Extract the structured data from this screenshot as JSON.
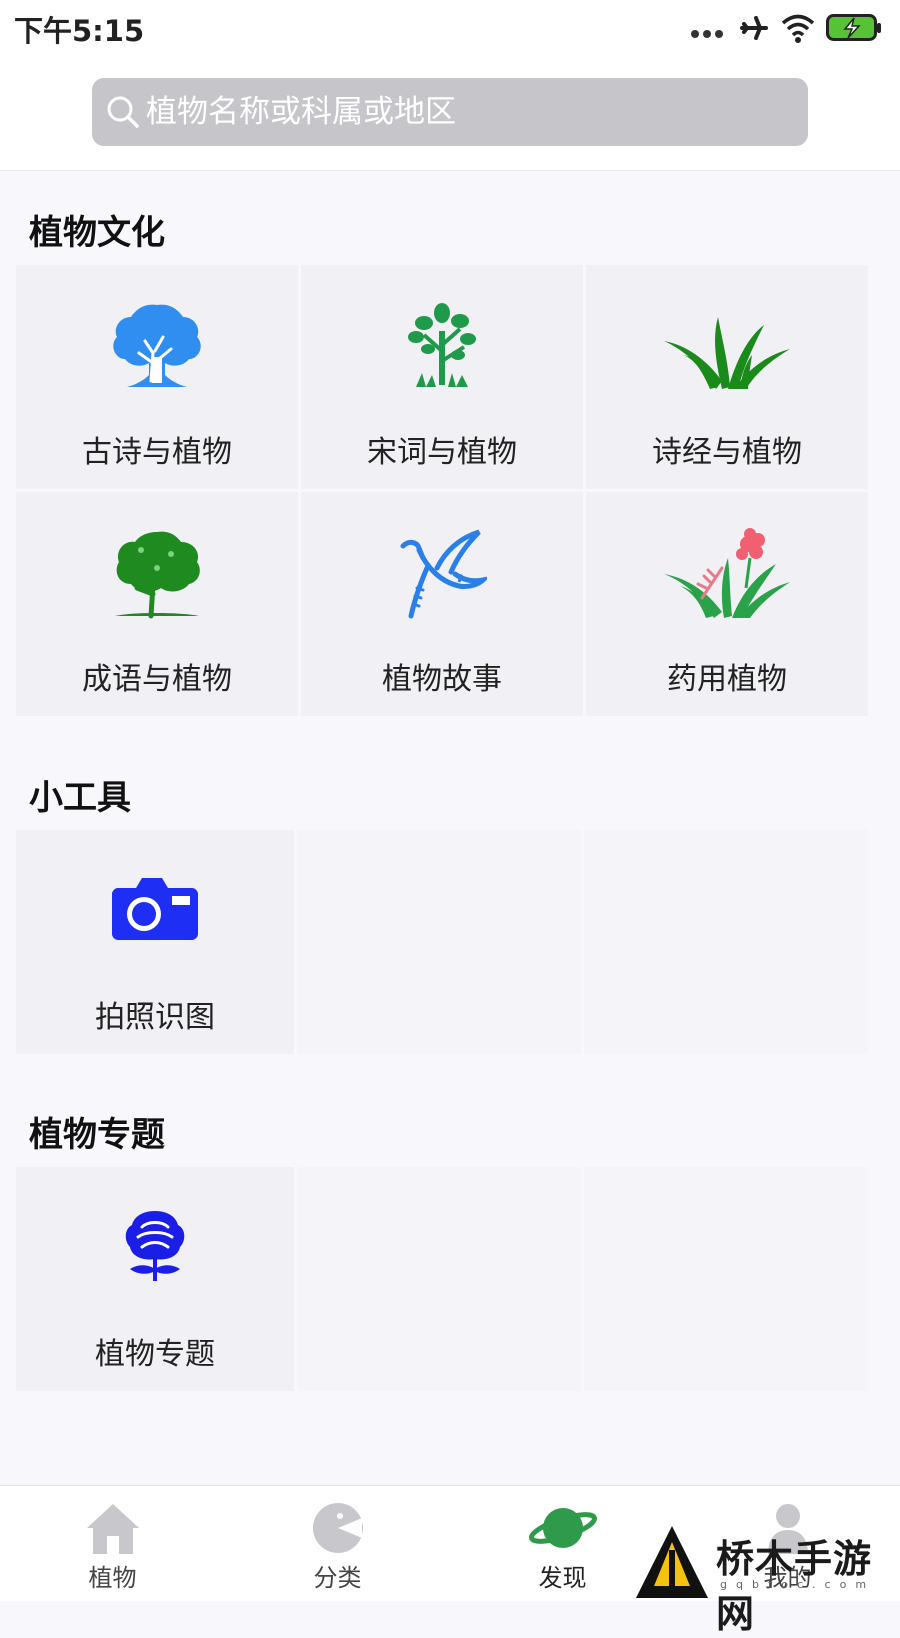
{
  "status_bar": {
    "time": "下午5:15",
    "icons": [
      "more-dots-icon",
      "airplane-icon",
      "wifi-icon",
      "battery-charging-icon"
    ]
  },
  "search": {
    "placeholder": "植物名称或科属或地区",
    "value": ""
  },
  "sections": {
    "culture": {
      "title": "植物文化",
      "items": [
        {
          "label": "古诗与植物",
          "icon": "blue-tree-icon",
          "color": "#2f8ef0"
        },
        {
          "label": "宋词与植物",
          "icon": "green-sapling-icon",
          "color": "#1f9a4a"
        },
        {
          "label": "诗经与植物",
          "icon": "grass-icon",
          "color": "#1a8a1a"
        },
        {
          "label": "成语与植物",
          "icon": "green-tree-icon",
          "color": "#1f8a1f"
        },
        {
          "label": "植物故事",
          "icon": "bird-icon",
          "color": "#2a7fe8"
        },
        {
          "label": "药用植物",
          "icon": "flower-grass-icon",
          "color": "#2aa24a"
        }
      ]
    },
    "tools": {
      "title": "小工具",
      "items": [
        {
          "label": "拍照识图",
          "icon": "camera-icon",
          "color": "#1e2ef5"
        }
      ]
    },
    "topics": {
      "title": "植物专题",
      "items": [
        {
          "label": "植物专题",
          "icon": "rose-icon",
          "color": "#1a1ee6"
        }
      ]
    }
  },
  "bottom_nav": {
    "items": [
      {
        "label": "植物",
        "icon": "home-icon"
      },
      {
        "label": "分类",
        "icon": "category-icon"
      },
      {
        "label": "发现",
        "icon": "planet-icon",
        "active": true
      },
      {
        "label": "我的",
        "icon": "person-icon"
      }
    ]
  },
  "watermark": {
    "text": "桥木手游网",
    "sub": "gqbtoc.com"
  }
}
